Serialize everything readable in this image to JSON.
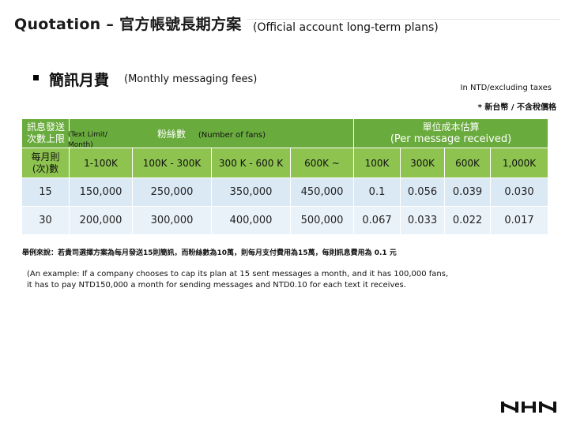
{
  "header": {
    "title": "Quotation – 官方帳號長期方案",
    "subtitle": "(Official account long-term plans)"
  },
  "section": {
    "title": "簡訊月費",
    "subtitle": "(Monthly messaging fees)"
  },
  "units": {
    "en": "In NTD/excluding taxes",
    "zh": "* 新台幣 / 不含稅價格"
  },
  "table": {
    "limit_header_zh_line1": "訊息發送",
    "limit_header_zh_line2": "次數上限",
    "limit_header_en_line1": "(Text Limit/",
    "limit_header_en_line2": "Month)",
    "fans_header_zh": "粉絲數",
    "fans_header_en": "(Number of fans)",
    "cost_header_zh": "單位成本估算",
    "cost_header_en": "(Per message received)",
    "sub_headers": [
      "每月則",
      "(次)數",
      "1-100K",
      "100K - 300K",
      "300 K - 600 K",
      "600K ~",
      "100K",
      "300K",
      "600K",
      "1,000K"
    ],
    "rows": [
      [
        "15",
        "150,000",
        "250,000",
        "350,000",
        "450,000",
        "0.1",
        "0.056",
        "0.039",
        "0.030"
      ],
      [
        "30",
        "200,000",
        "300,000",
        "400,000",
        "500,000",
        "0.067",
        "0.033",
        "0.022",
        "0.017"
      ]
    ]
  },
  "example": {
    "zh": "舉例來說：若貴司選擇方案為每月發送15則簡訊，而粉絲數為10萬，則每月支付費用為15萬，每則訊息費用為 0.1 元",
    "en": "(An example: If a company chooses to cap its plan at 15 sent messages a month, and it has 100,000 fans, it has to pay NTD150,000 a month for sending messages and NTD0.10 for each text it receives."
  },
  "logo": {
    "name": "nhn-logo",
    "text": "NHN"
  }
}
